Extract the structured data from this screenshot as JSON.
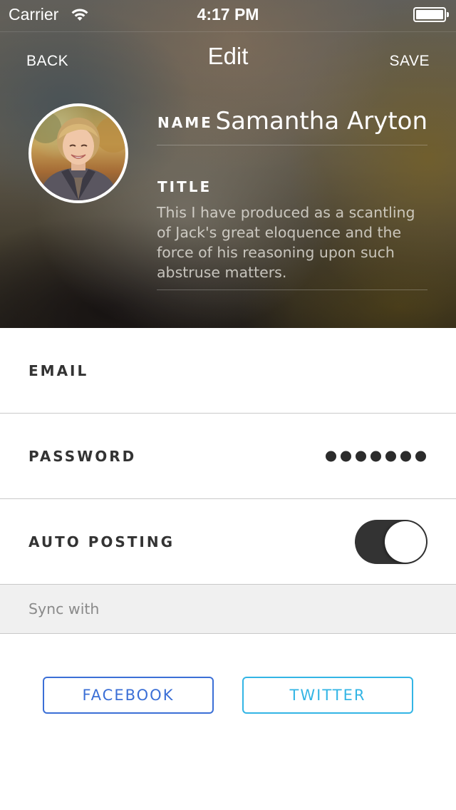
{
  "status_bar": {
    "carrier": "Carrier",
    "time": "4:17 PM",
    "wifi_icon": "wifi-icon",
    "battery_icon": "battery-full-icon"
  },
  "nav": {
    "back_label": "BACK",
    "title": "Edit",
    "save_label": "SAVE"
  },
  "profile": {
    "avatar": "profile-photo",
    "name_label": "NAME",
    "name_value": "Samantha Aryton",
    "title_label": "TITLE",
    "title_value": "This I have produced as a scantling of Jack's great eloquence and the force of his reasoning upon such abstruse matters."
  },
  "form": {
    "email_label": "EMAIL",
    "email_value": "",
    "password_label": "PASSWORD",
    "password_masked_length": 7,
    "auto_posting_label": "AUTO POSTING",
    "auto_posting_on": true
  },
  "sync": {
    "header": "Sync with",
    "facebook_label": "FACEBOOK",
    "twitter_label": "TWITTER"
  },
  "colors": {
    "facebook": "#3b6fd6",
    "twitter": "#33b5e5",
    "toggle_on": "#333333",
    "section_bg": "#f0f0f0"
  }
}
